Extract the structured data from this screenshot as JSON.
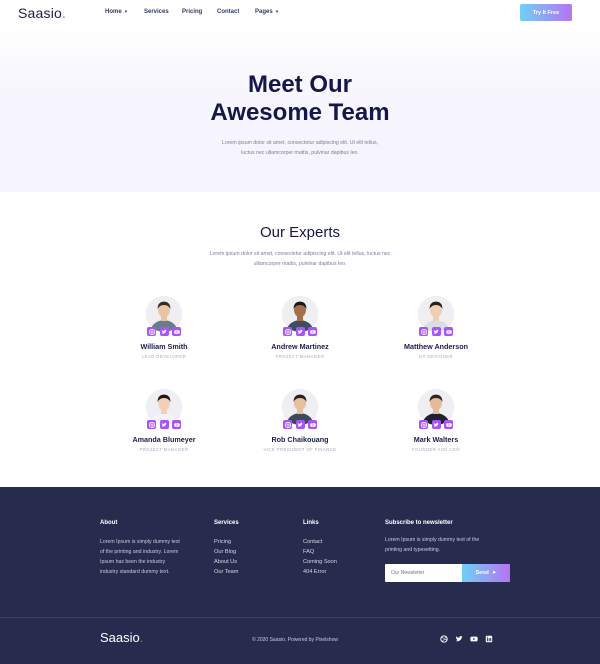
{
  "nav": {
    "logo": "Saasio",
    "logo_dot": ".",
    "items": [
      {
        "label": "Home",
        "has_dropdown": true
      },
      {
        "label": "Services",
        "has_dropdown": false
      },
      {
        "label": "Pricing",
        "has_dropdown": false
      },
      {
        "label": "Contact",
        "has_dropdown": false
      },
      {
        "label": "Pages",
        "has_dropdown": true
      }
    ],
    "cta": "Try It Free"
  },
  "hero": {
    "title_line1": "Meet Our",
    "title_line2": "Awesome Team",
    "subtitle_line1": "Lorem ipsum dolor sit amet, consectetur adipiscing elit. Ut elit tellus,",
    "subtitle_line2": "luctus nec ullamcorper mattis, pulvinar dapibus leo."
  },
  "experts": {
    "title": "Our Experts",
    "subtitle_line1": "Lorem ipsum dolor sit amet, consectetur adipiscing elit. Ut elit tellus, luctus nec",
    "subtitle_line2": "ullamcorper mattis, pulvinar dapibus leo.",
    "members": [
      {
        "name": "William Smith",
        "role": "LEAD DEVELOPER"
      },
      {
        "name": "Andrew Martinez",
        "role": "PROJECT MANAGER"
      },
      {
        "name": "Matthew Anderson",
        "role": "UX DESIGNER"
      },
      {
        "name": "Amanda Blumeyer",
        "role": "PROJECT MANAGER"
      },
      {
        "name": "Rob Chaikouang",
        "role": "VICE PRESIDENT OF FINANCE"
      },
      {
        "name": "Mark Walters",
        "role": "FOUNDER AND CEO"
      }
    ],
    "social_icons": [
      "instagram-icon",
      "twitter-icon",
      "youtube-icon"
    ]
  },
  "footer": {
    "about": {
      "title": "About",
      "lines": [
        "Lorem Ipsum is simply dummy text",
        "of the printing and industry. Lorem",
        "Ipsum has been the industry",
        "industry standard dummy text."
      ]
    },
    "services": {
      "title": "Services",
      "links": [
        "Pricing",
        "Our Blog",
        "About Us",
        "Our Team"
      ]
    },
    "links": {
      "title": "Links",
      "links": [
        "Contact",
        "FAQ",
        "Coming Soon",
        "404 Error"
      ]
    },
    "newsletter": {
      "title": "Subscribe to newsletter",
      "line1": "Lorem Ipsum is simply dummy text of the",
      "line2": "printing and typesetting.",
      "placeholder": "Our Newsletter",
      "button": "Send"
    },
    "logo": "Saasio",
    "logo_dot": ".",
    "copyright": "© 2020 Saasio. Powered by Pixelshow",
    "social_icons": [
      "dribbble-icon",
      "twitter-icon",
      "youtube-icon",
      "linkedin-icon"
    ]
  },
  "colors": {
    "accent": "#a855f7",
    "navy": "#15164a",
    "footer_bg": "#272b4e"
  }
}
